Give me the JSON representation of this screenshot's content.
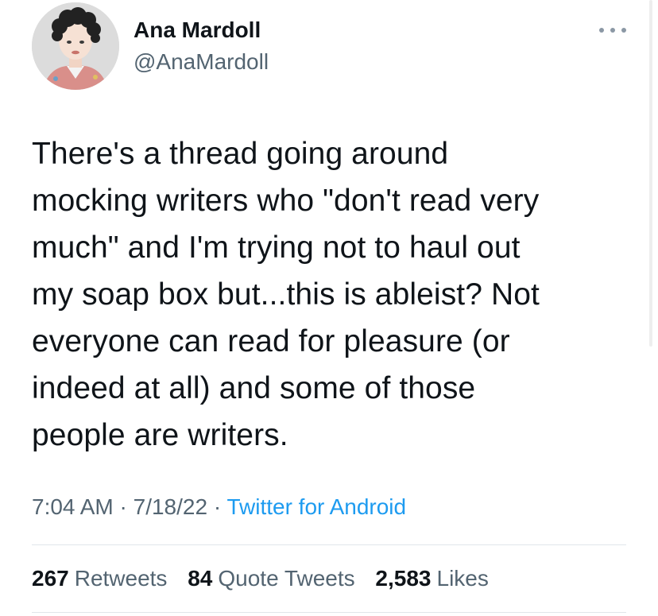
{
  "author": {
    "name": "Ana Mardoll",
    "handle": "@AnaMardoll"
  },
  "tweet": {
    "text": "There's a thread going around\nmocking writers who \"don't read very\nmuch\" and I'm trying not to haul out\nmy soap box but...this is ableist? Not\neveryone can read for pleasure (or\nindeed at all) and some of those\npeople are writers.",
    "time": "7:04 AM",
    "date": "7/18/22",
    "source": "Twitter for Android",
    "separator": "·"
  },
  "stats": {
    "retweets": {
      "count": "267",
      "label": "Retweets"
    },
    "quotes": {
      "count": "84",
      "label": "Quote Tweets"
    },
    "likes": {
      "count": "2,583",
      "label": "Likes"
    }
  },
  "icons": {
    "more": "more-horizontal-icon",
    "avatar": "profile-avatar"
  },
  "colors": {
    "text": "#0f1419",
    "secondary": "#536471",
    "link": "#1d9bf0"
  }
}
